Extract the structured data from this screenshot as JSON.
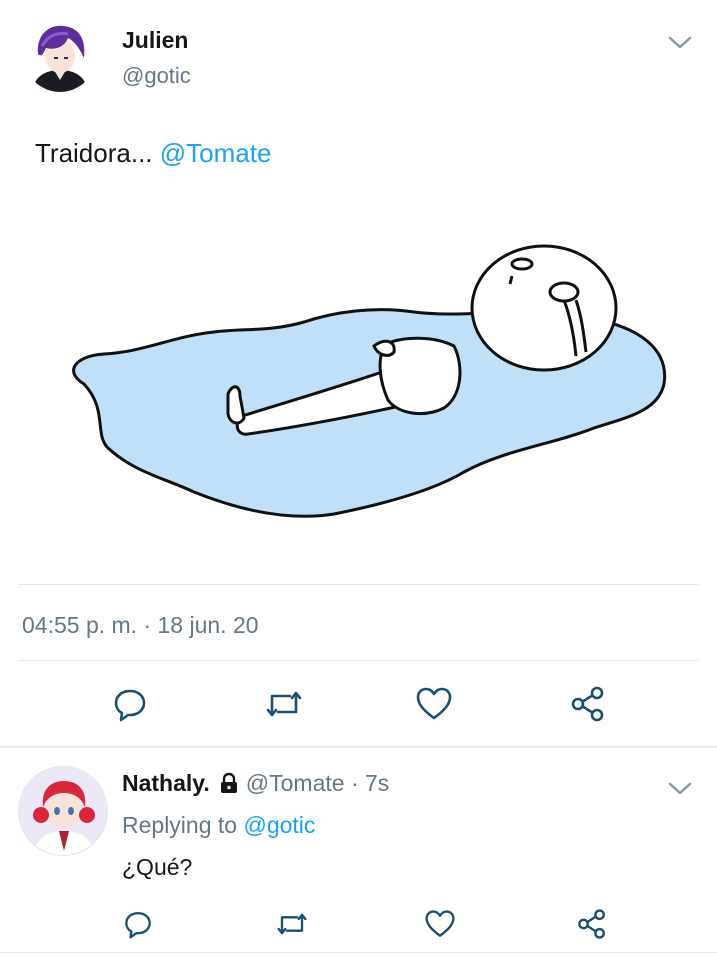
{
  "tweet": {
    "author_name": "Julien",
    "author_handle": "@gotic",
    "text": "Traidora... ",
    "mention": "@Tomate",
    "timestamp": "04:55 p. m. · 18 jun. 20",
    "media": {
      "description_icon": "crying-puddle-meme-image"
    },
    "actions": [
      "reply-icon",
      "retweet-icon",
      "like-icon",
      "share-icon"
    ]
  },
  "reply": {
    "author_name": "Nathaly.",
    "author_handle": "@Tomate",
    "time_sep": " · ",
    "time": "7s",
    "replying_label": "Replying to ",
    "replying_to": "@gotic",
    "text": "¿Qué?",
    "actions": [
      "reply-icon",
      "retweet-icon",
      "like-icon",
      "share-icon"
    ]
  },
  "colors": {
    "accent": "#1da1f2",
    "secondary_text": "#657786",
    "primary_text": "#14171a",
    "divider": "#e1e8ed",
    "icon": "#1b4f72",
    "puddle": "#bfe0f7"
  }
}
